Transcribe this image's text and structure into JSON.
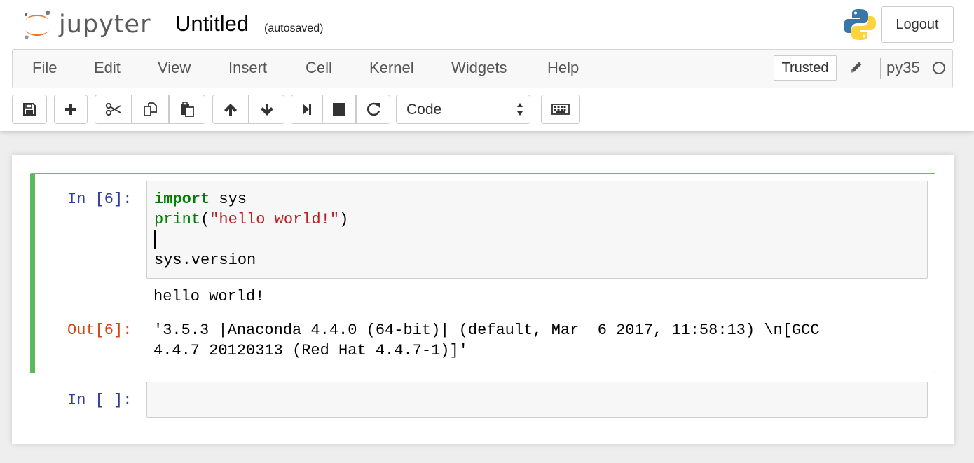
{
  "header": {
    "logo_text": "jupyter",
    "notebook_name": "Untitled",
    "autosave_status": "(autosaved)",
    "logout_label": "Logout",
    "python_logo_icon": "python-logo-icon"
  },
  "menubar": {
    "items": [
      "File",
      "Edit",
      "View",
      "Insert",
      "Cell",
      "Kernel",
      "Widgets",
      "Help"
    ],
    "trusted_label": "Trusted",
    "kernel_name": "py35",
    "kernel_status": "idle"
  },
  "toolbar": {
    "icons": [
      "save-icon",
      "plus-icon",
      "cut-icon",
      "copy-icon",
      "paste-icon",
      "arrow-up-icon",
      "arrow-down-icon",
      "run-icon",
      "stop-icon",
      "restart-icon",
      "keyboard-icon"
    ],
    "cell_type": "Code"
  },
  "cells": [
    {
      "in_prompt": "In [6]:",
      "code": {
        "line1_keyword": "import",
        "line1_rest": " sys",
        "line2_builtin": "print",
        "line2_open": "(",
        "line2_string": "\"hello world!\"",
        "line2_close": ")",
        "line4": "sys.version"
      },
      "stream_output": "hello world!",
      "out_prompt": "Out[6]:",
      "result_line1": "'3.5.3 |Anaconda 4.4.0 (64-bit)| (default, Mar  6 2017, 11:58:13) \\n[GCC",
      "result_line2": "4.4.7 20120313 (Red Hat 4.4.7-1)]'"
    },
    {
      "in_prompt": "In [ ]:",
      "code": ""
    }
  ],
  "colors": {
    "selected_cell_border": "#5cb85c",
    "in_prompt": "#303f9f",
    "out_prompt": "#d84315",
    "keyword": "#008000",
    "string": "#ba2121"
  }
}
